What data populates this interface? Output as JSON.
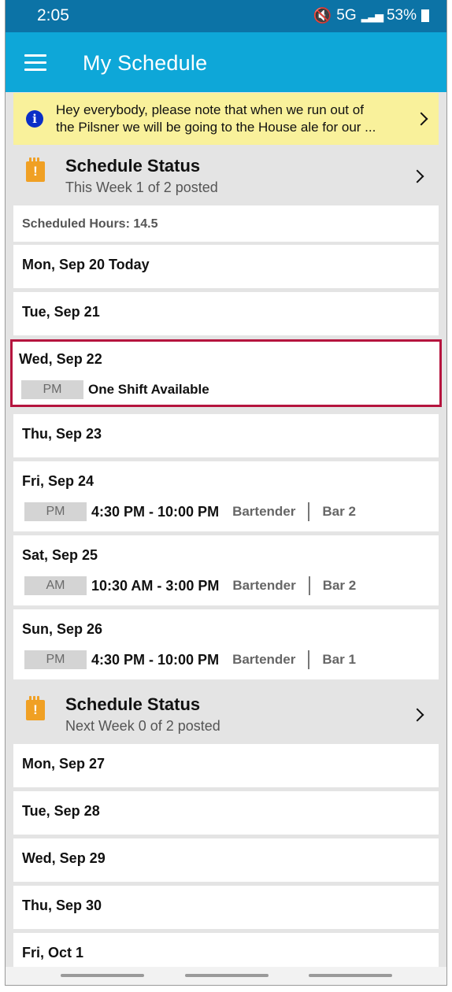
{
  "status_bar": {
    "time": "2:05",
    "network": "5G",
    "battery": "53%"
  },
  "app_bar": {
    "title": "My Schedule"
  },
  "notice": {
    "line1": "Hey everybody, please note that when we run out of",
    "line2": "the Pilsner we will be going to the House ale for our ..."
  },
  "this_week": {
    "title": "Schedule Status",
    "subtitle": "This Week 1 of 2 posted",
    "scheduled_hours": "Scheduled Hours: 14.5",
    "days": [
      {
        "date": "Mon, Sep 20 Today"
      },
      {
        "date": "Tue, Sep 21"
      },
      {
        "date": "Wed, Sep 22",
        "shift": {
          "period": "PM",
          "text": "One Shift Available"
        }
      },
      {
        "date": "Thu, Sep 23"
      },
      {
        "date": "Fri, Sep 24",
        "shift": {
          "period": "PM",
          "time": "4:30 PM - 10:00 PM",
          "role": "Bartender",
          "location": "Bar 2"
        }
      },
      {
        "date": "Sat, Sep 25",
        "shift": {
          "period": "AM",
          "time": "10:30 AM - 3:00 PM",
          "role": "Bartender",
          "location": "Bar 2"
        }
      },
      {
        "date": "Sun, Sep 26",
        "shift": {
          "period": "PM",
          "time": "4:30 PM - 10:00 PM",
          "role": "Bartender",
          "location": "Bar 1"
        }
      }
    ]
  },
  "next_week": {
    "title": "Schedule Status",
    "subtitle": "Next Week 0 of 2 posted",
    "days": [
      {
        "date": "Mon, Sep 27"
      },
      {
        "date": "Tue, Sep 28"
      },
      {
        "date": "Wed, Sep 29"
      },
      {
        "date": "Thu, Sep 30"
      },
      {
        "date": "Fri, Oct 1"
      }
    ]
  },
  "colors": {
    "header": "#0ea7d8",
    "status_bar": "#0c73a6",
    "notice": "#f9f19b",
    "selected_border": "#b5143e",
    "warning_icon": "#f0a024"
  }
}
